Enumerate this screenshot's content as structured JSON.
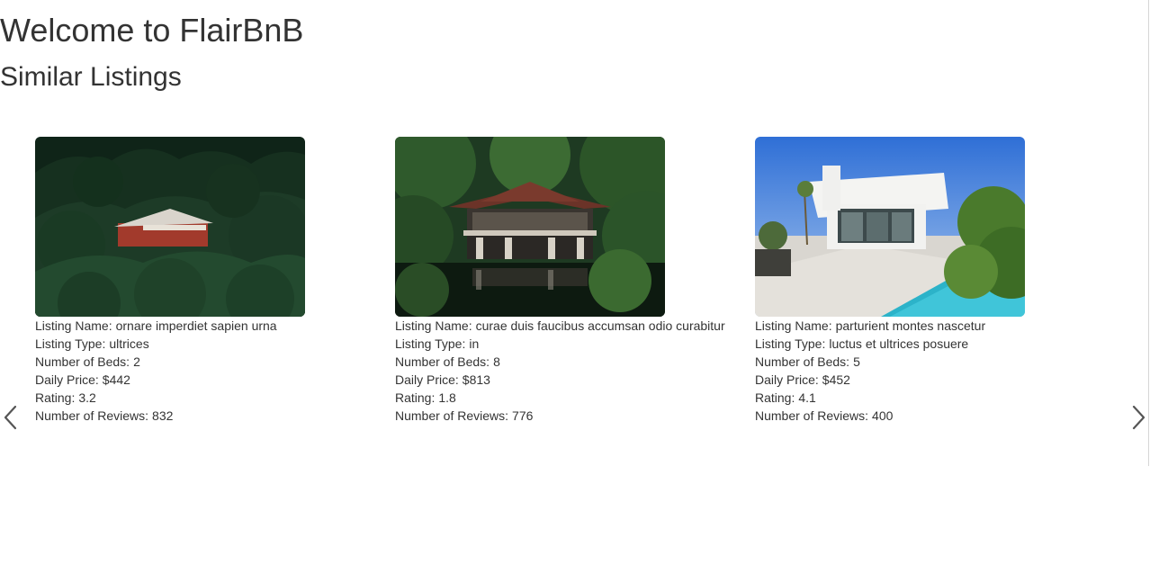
{
  "header": {
    "title": "Welcome to FlairBnB",
    "subtitle": "Similar Listings"
  },
  "carousel": {
    "prev_icon": "chevron-left-icon",
    "next_icon": "chevron-right-icon",
    "arrow_color": "#555555"
  },
  "labels": {
    "name": "Listing Name:",
    "type": "Listing Type:",
    "beds": "Number of Beds:",
    "price": "Daily Price:",
    "rating": "Rating:",
    "reviews": "Number of Reviews:"
  },
  "listings": [
    {
      "image": "red cabin in dark forest",
      "name": "ornare imperdiet sapien urna",
      "type": "ultrices",
      "beds": "2",
      "price": "$442",
      "rating": "3.2",
      "reviews": "832"
    },
    {
      "image": "pagoda pavilion over pond in forest",
      "name": "curae duis faucibus accumsan odio curabitur",
      "type": "in",
      "beds": "8",
      "price": "$813",
      "rating": "1.8",
      "reviews": "776"
    },
    {
      "image": "modern white house with pool",
      "name": "parturient montes nascetur",
      "type": "luctus et ultrices posuere",
      "beds": "5",
      "price": "$452",
      "rating": "4.1",
      "reviews": "400"
    }
  ]
}
